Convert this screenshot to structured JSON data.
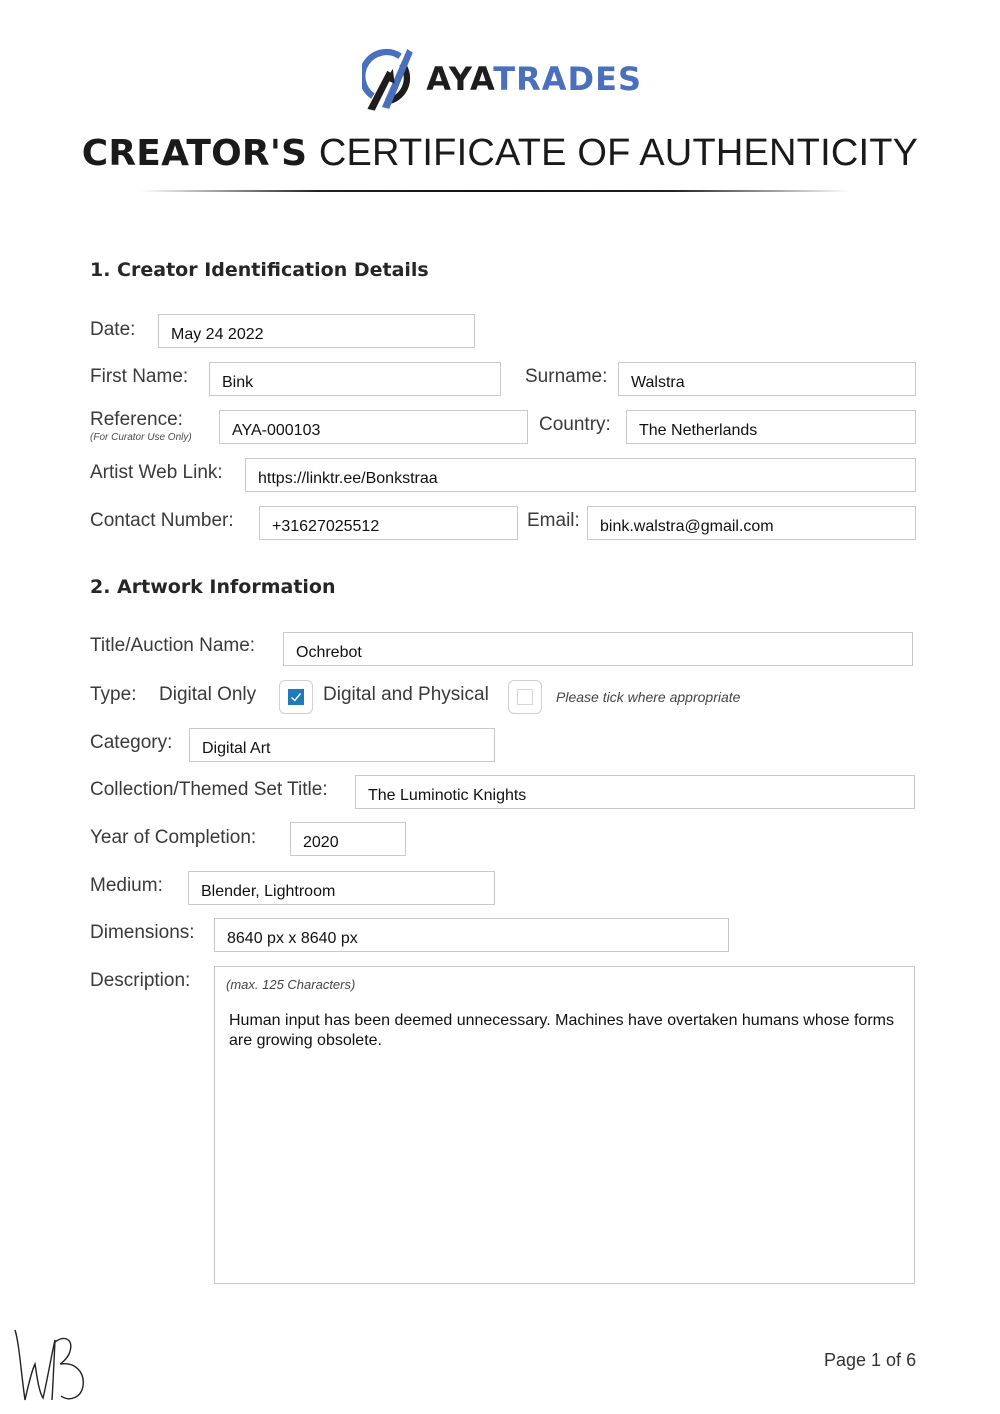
{
  "header": {
    "logo": {
      "icon": "ayatrades-logo-icon",
      "brand_part1": "AYA",
      "brand_part2": "TRADES",
      "brand_color": "#4a6fbd"
    },
    "title_bold": "CREATOR'S",
    "title_light": "CERTIFICATE OF AUTHENTICITY"
  },
  "section1": {
    "heading": "1. Creator Identification Details",
    "date": {
      "label": "Date:",
      "value": "May 24 2022"
    },
    "first_name": {
      "label": "First Name:",
      "value": "Bink"
    },
    "surname": {
      "label": "Surname:",
      "value": "Walstra"
    },
    "reference": {
      "label": "Reference:",
      "sublabel": "(For Curator Use Only)",
      "value": "AYA-000103"
    },
    "country": {
      "label": "Country:",
      "value": "The Netherlands"
    },
    "web_link": {
      "label": "Artist Web Link:",
      "value": "https://linktr.ee/Bonkstraa"
    },
    "contact": {
      "label": "Contact Number:",
      "value": "+31627025512"
    },
    "email": {
      "label": "Email:",
      "value": "bink.walstra@gmail.com"
    }
  },
  "section2": {
    "heading": "2. Artwork Information",
    "title": {
      "label": "Title/Auction Name:",
      "value": "Ochrebot"
    },
    "type": {
      "label": "Type:",
      "options": [
        {
          "label": "Digital Only",
          "checked": true
        },
        {
          "label": "Digital and Physical",
          "checked": false
        }
      ],
      "hint": "Please tick where appropriate",
      "check_color": "#1f7ab8"
    },
    "category": {
      "label": "Category:",
      "value": "Digital Art"
    },
    "collection": {
      "label": "Collection/Themed Set Title:",
      "value": "The Luminotic Knights"
    },
    "year": {
      "label": "Year of Completion:",
      "value": "2020"
    },
    "medium": {
      "label": "Medium:",
      "value": "Blender, Lightroom"
    },
    "dimensions": {
      "label": "Dimensions:",
      "value": "8640 px x 8640 px"
    },
    "description": {
      "label": "Description:",
      "hint": "(max. 125 Characters)",
      "value": "Human input has been deemed unnecessary. Machines have overtaken humans whose forms are growing obsolete."
    }
  },
  "footer": {
    "signature": "signature-initials-WB",
    "page_label": "Page 1 of 6"
  }
}
